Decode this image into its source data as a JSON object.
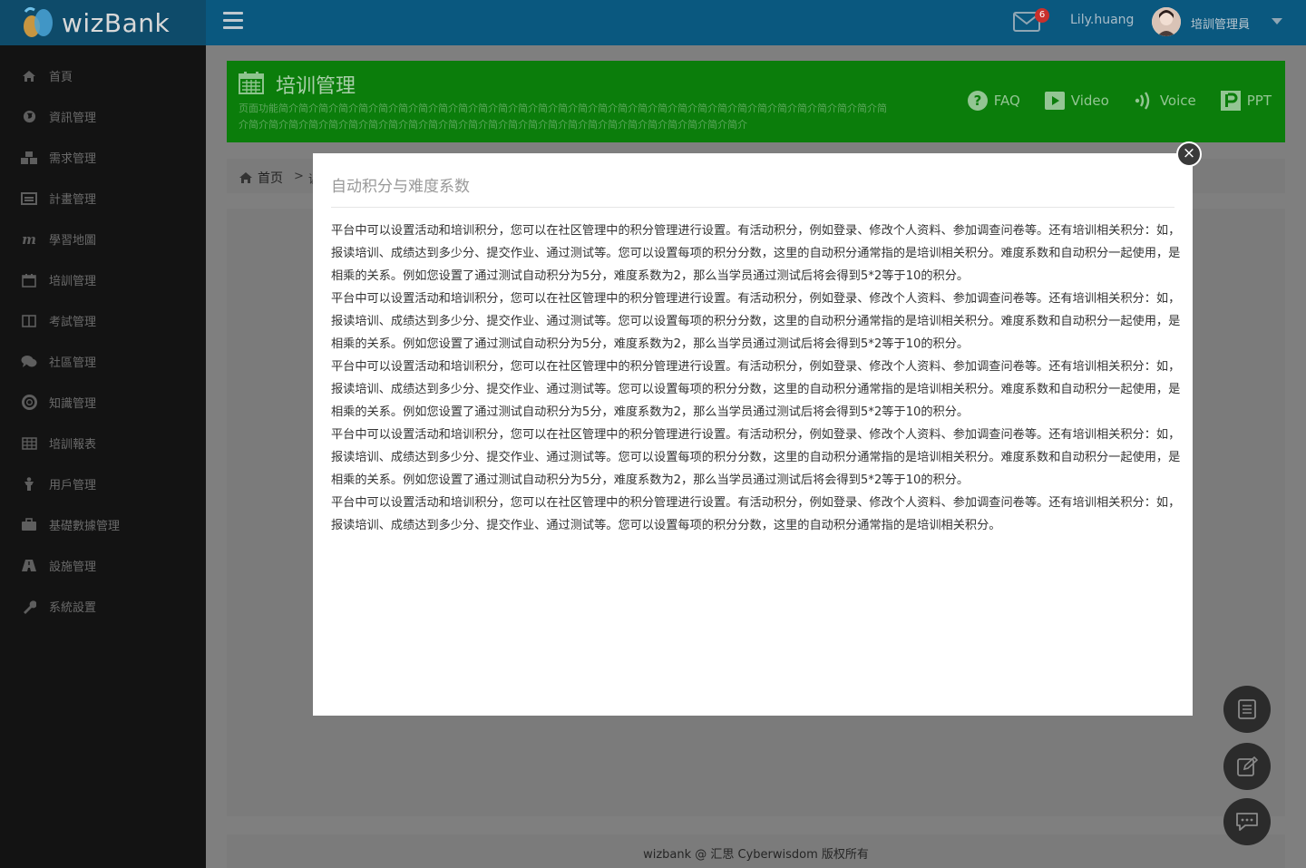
{
  "header": {
    "logo_text": "wizBank",
    "mail_count": "6",
    "username": "Lily.huang",
    "role": "培訓管理員"
  },
  "sidebar": {
    "items": [
      {
        "label": "首頁",
        "icon": "home-icon"
      },
      {
        "label": "資訊管理",
        "icon": "globe-icon"
      },
      {
        "label": "需求管理",
        "icon": "cubes-icon"
      },
      {
        "label": "計畫管理",
        "icon": "list-card-icon"
      },
      {
        "label": "學習地圖",
        "icon": "map-m-icon"
      },
      {
        "label": "培訓管理",
        "icon": "calendar-icon"
      },
      {
        "label": "考試管理",
        "icon": "book-icon"
      },
      {
        "label": "社區管理",
        "icon": "chat-bubbles-icon"
      },
      {
        "label": "知識管理",
        "icon": "lifebuoy-icon"
      },
      {
        "label": "培訓報表",
        "icon": "table-icon"
      },
      {
        "label": "用戶管理",
        "icon": "user-icon"
      },
      {
        "label": "基礎數據管理",
        "icon": "briefcase-icon"
      },
      {
        "label": "設施管理",
        "icon": "road-icon"
      },
      {
        "label": "系統設置",
        "icon": "wrench-icon"
      }
    ]
  },
  "page_header": {
    "title": "培训管理",
    "description": "页面功能简介简介简介简介简介简介简介简介简介简介简介简介简介简介简介简介简介简介简介简介简介简介简介简介简介简介简介简介简介简介简介简介简介简介简介简介简介简介简介简介简介简介简介简介简介简介简介简介简介简介简介简介简介简介简介简介",
    "links": {
      "faq": "FAQ",
      "video": "Video",
      "voice": "Voice",
      "ppt": "PPT"
    }
  },
  "breadcrumb": {
    "home": "首页",
    "separator": ">",
    "next": "课"
  },
  "modal": {
    "title": "自动积分与难度系数",
    "paragraphs": [
      "平台中可以设置活动和培训积分，您可以在社区管理中的积分管理进行设置。有活动积分，例如登录、修改个人资料、参加调查问卷等。还有培训相关积分：如，报读培训、成绩达到多少分、提交作业、通过测试等。您可以设置每项的积分分数，这里的自动积分通常指的是培训相关积分。难度系数和自动积分一起使用，是相乘的关系。例如您设置了通过测试自动积分为5分，难度系数为2，那么当学员通过测试后将会得到5*2等于10的积分。",
      "平台中可以设置活动和培训积分，您可以在社区管理中的积分管理进行设置。有活动积分，例如登录、修改个人资料、参加调查问卷等。还有培训相关积分：如，报读培训、成绩达到多少分、提交作业、通过测试等。您可以设置每项的积分分数，这里的自动积分通常指的是培训相关积分。难度系数和自动积分一起使用，是相乘的关系。例如您设置了通过测试自动积分为5分，难度系数为2，那么当学员通过测试后将会得到5*2等于10的积分。",
      "平台中可以设置活动和培训积分，您可以在社区管理中的积分管理进行设置。有活动积分，例如登录、修改个人资料、参加调查问卷等。还有培训相关积分：如，报读培训、成绩达到多少分、提交作业、通过测试等。您可以设置每项的积分分数，这里的自动积分通常指的是培训相关积分。难度系数和自动积分一起使用，是相乘的关系。例如您设置了通过测试自动积分为5分，难度系数为2，那么当学员通过测试后将会得到5*2等于10的积分。",
      "平台中可以设置活动和培训积分，您可以在社区管理中的积分管理进行设置。有活动积分，例如登录、修改个人资料、参加调查问卷等。还有培训相关积分：如，报读培训、成绩达到多少分、提交作业、通过测试等。您可以设置每项的积分分数，这里的自动积分通常指的是培训相关积分。难度系数和自动积分一起使用，是相乘的关系。例如您设置了通过测试自动积分为5分，难度系数为2，那么当学员通过测试后将会得到5*2等于10的积分。",
      "平台中可以设置活动和培训积分，您可以在社区管理中的积分管理进行设置。有活动积分，例如登录、修改个人资料、参加调查问卷等。还有培训相关积分：如，报读培训、成绩达到多少分、提交作业、通过测试等。您可以设置每项的积分分数，这里的自动积分通常指的是培训相关积分。"
    ],
    "close_symbol": "×"
  },
  "footer": {
    "text": "wizbank @ 汇思 Cyberwisdom 版权所有"
  },
  "fabs": [
    "notes-icon",
    "edit-icon",
    "chat-icon"
  ],
  "colors": {
    "topbar": "#0a587f",
    "logo_bg": "#0e4b6a",
    "sidebar": "#131313",
    "page_header": "#0b7d0b",
    "overlay_panel": "#7b7b7b",
    "modal_bg": "#ffffff",
    "mail_badge": "#c9302c"
  }
}
